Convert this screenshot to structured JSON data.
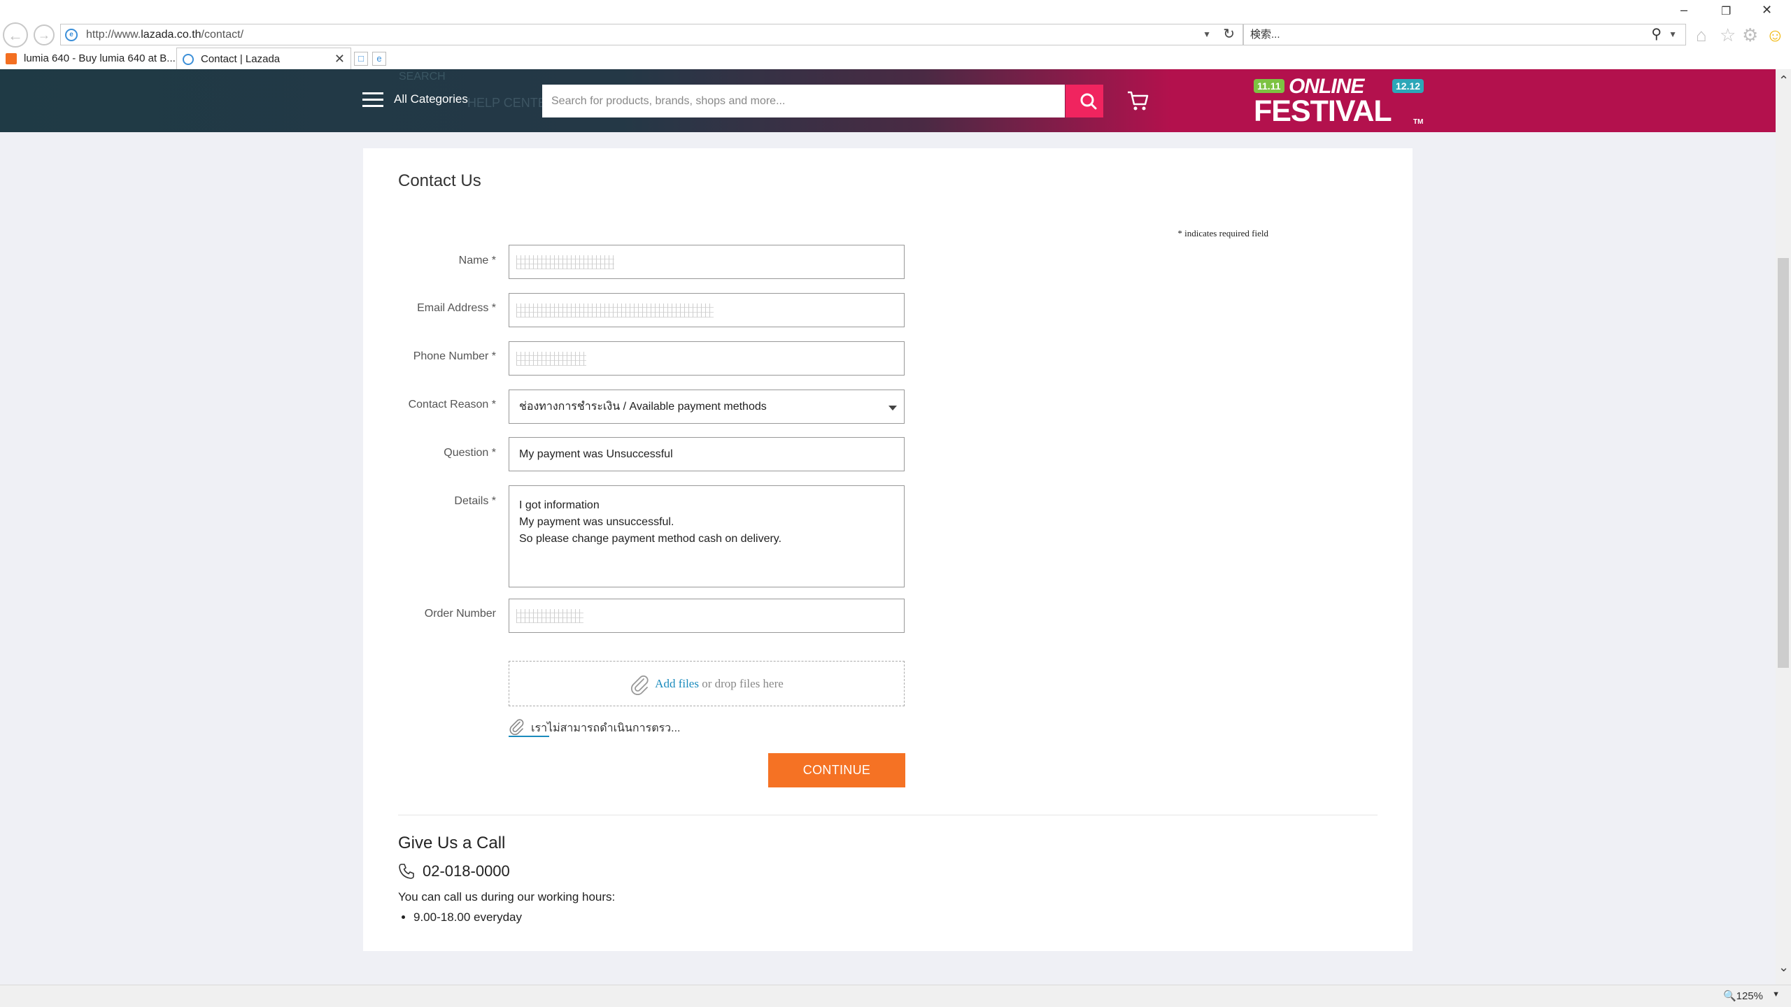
{
  "browser": {
    "url_prefix": "http://www.",
    "url_domain": "lazada.co.th",
    "url_path": "/contact/",
    "search_placeholder": "検索...",
    "tabs": [
      {
        "label": "lumia 640 - Buy lumia 640 at B..."
      },
      {
        "label": "Contact | Lazada"
      }
    ],
    "zoom": "125%"
  },
  "header": {
    "ghost_search": "SEARCH",
    "ghost_help": "HELP CENTER",
    "all_categories": "All Categories",
    "search_placeholder": "Search for products, brands, shops and more...",
    "promo": {
      "badge_left": "11.11",
      "online": "ONLINE",
      "badge_right": "12.12",
      "festival": "FESTIVAL",
      "tm": "TM"
    }
  },
  "page": {
    "title": "Contact Us",
    "required_note": "* indicates required field"
  },
  "form": {
    "name_label": "Name *",
    "email_label": "Email Address *",
    "phone_label": "Phone Number *",
    "reason_label": "Contact Reason *",
    "reason_value": "ช่องทางการชำระเงิน / Available payment methods",
    "question_label": "Question *",
    "question_value": "My payment was Unsuccessful",
    "details_label": "Details *",
    "details_value": "I got information\nMy payment was unsuccessful.\nSo please change payment method cash on delivery.",
    "order_label": "Order Number",
    "dropzone_add": "Add files",
    "dropzone_rest": " or drop files here",
    "attached_file": "เราไม่สามารถดำเนินการตรว...",
    "continue_label": "CONTINUE"
  },
  "call": {
    "title": "Give Us a Call",
    "phone": "02-018-0000",
    "hours_intro": "You can call us during our working hours:",
    "hours": [
      "9.00-18.00 everyday"
    ]
  },
  "colors": {
    "accent_orange": "#f57224",
    "search_pink": "#f0245f",
    "link_blue": "#1a8bbd"
  }
}
